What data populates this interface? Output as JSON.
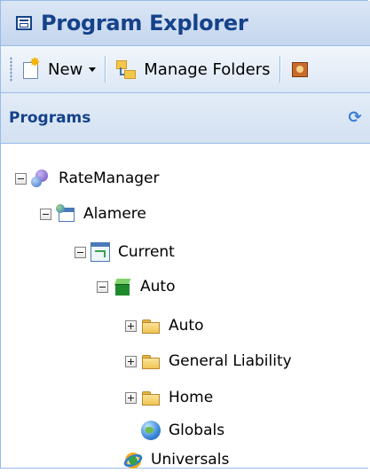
{
  "header": {
    "title": "Program Explorer"
  },
  "toolbar": {
    "new_label": "New",
    "manage_folders_label": "Manage Folders"
  },
  "programs_panel": {
    "title": "Programs"
  },
  "tree": {
    "ratemanager": "RateManager",
    "alamere": "Alamere",
    "current": "Current",
    "auto_program": "Auto",
    "auto_folder": "Auto",
    "general_liability": "General Liability",
    "home": "Home",
    "globals": "Globals",
    "universals": "Universals"
  },
  "colors": {
    "header_text": "#15428b",
    "border": "#99bbe8",
    "header_bg": "#c4d6ee"
  },
  "icons": [
    "window-icon",
    "new-page-icon",
    "manage-folders-icon",
    "refresh-icon",
    "folder-icon",
    "globe-icon",
    "cube-icon"
  ]
}
